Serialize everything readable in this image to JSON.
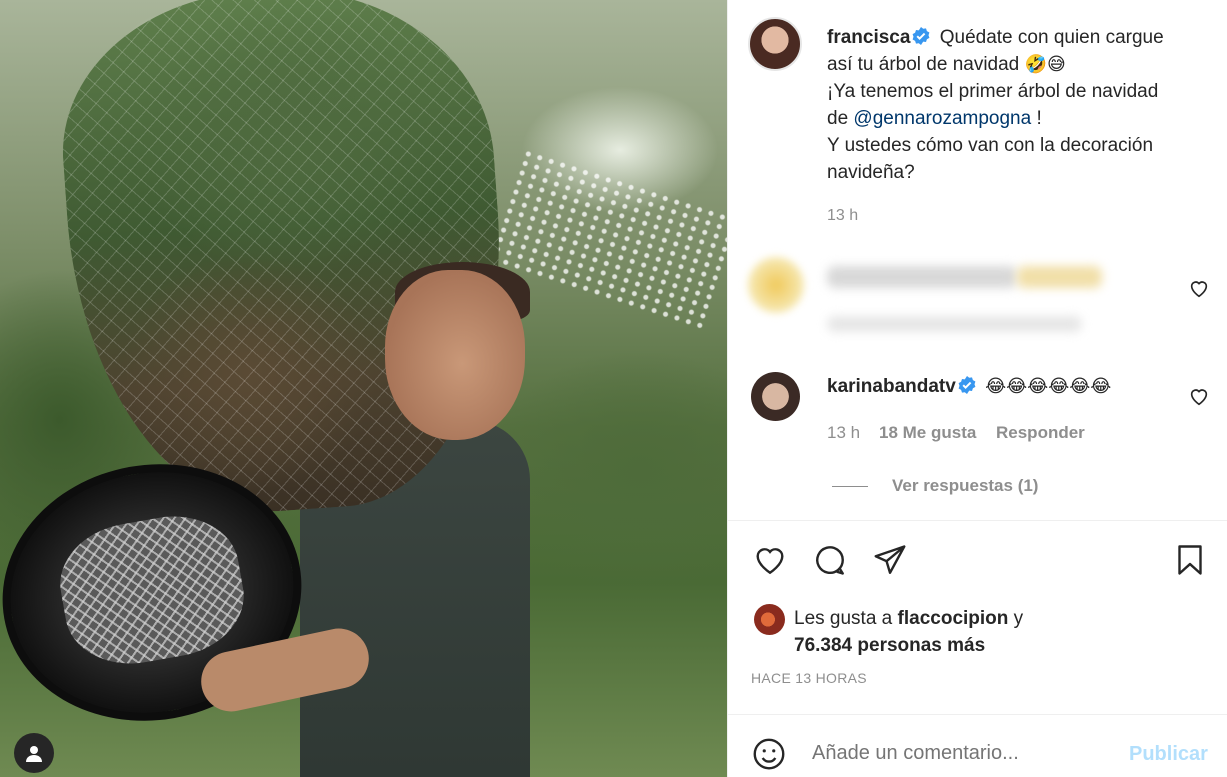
{
  "post": {
    "author": "francisca",
    "caption_line1": "Quédate con quien cargue",
    "caption_line2": "así tu árbol de navidad",
    "caption_emojis": "🤣😅",
    "caption_line3": "¡Ya tenemos el primer árbol de navidad",
    "caption_line4_prefix": "de",
    "mention": "@gennarozampogna",
    "caption_line4_suffix": "!",
    "caption_line5": "Y ustedes cómo van con la decoración",
    "caption_line6": "navideña?",
    "caption_time": "13 h"
  },
  "comments": [
    {
      "username": "karinabandatv",
      "text": "😂😂😂😂😂😂",
      "time": "13 h",
      "likes": "18 Me gusta",
      "reply_label": "Responder",
      "view_replies": "Ver respuestas (1)"
    }
  ],
  "likes": {
    "prefix": "Les gusta a",
    "user": "flaccocipion",
    "conj": "y",
    "count": "76.384 personas más"
  },
  "posted_ago": "HACE 13 HORAS",
  "comment_input": {
    "placeholder": "Añade un comentario..."
  },
  "publish_label": "Publicar",
  "icons": {
    "like": "heart-icon",
    "comment": "comment-icon",
    "share": "send-icon",
    "save": "bookmark-icon",
    "emoji": "smiley-icon",
    "verified": "verified-badge-icon",
    "profile": "user-icon"
  },
  "colors": {
    "verified": "#3897f0",
    "mention": "#00376b",
    "muted": "#8e8e8e",
    "publish": "#b2dffc"
  }
}
